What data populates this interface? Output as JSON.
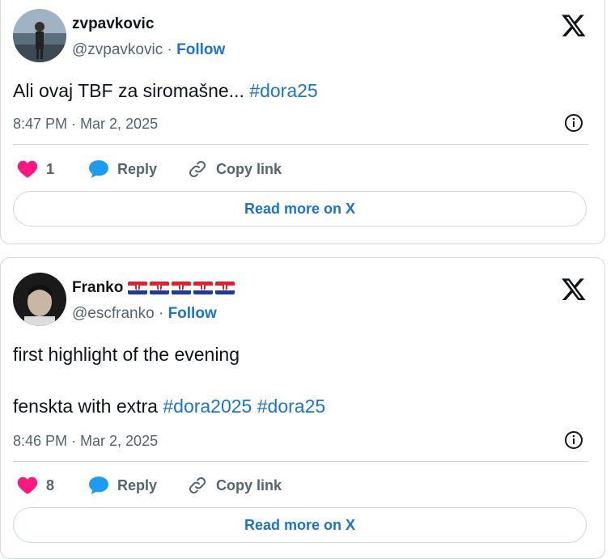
{
  "tweets": [
    {
      "name": "zvpavkovic",
      "handle": "@zvpavkovic",
      "separator": " · ",
      "follow_label": "Follow",
      "text_plain": "Ali ovaj TBF za siromašne... ",
      "hashtag": "#dora25",
      "timestamp": "8:47 PM · Mar 2, 2025",
      "likes": "1",
      "reply_label": "Reply",
      "copy_label": "Copy link",
      "read_more_label": "Read more on X"
    },
    {
      "name": "Franko",
      "flag_icon": "croatia-flag-icon",
      "flag_count": 5,
      "handle": "@escfranko",
      "separator": " · ",
      "follow_label": "Follow",
      "text_line1": "first highlight of the evening",
      "text_line2_plain": "fenskta with extra ",
      "hashtag1": "#dora2025",
      "hashtag2": "#dora25",
      "timestamp": "8:46 PM · Mar 2, 2025",
      "likes": "8",
      "reply_label": "Reply",
      "copy_label": "Copy link",
      "read_more_label": "Read more on X"
    }
  ],
  "colors": {
    "link": "#1d73c8",
    "heart": "#f91880",
    "reply": "#1d9bf0",
    "muted": "#536471",
    "border": "#cfd9de"
  }
}
